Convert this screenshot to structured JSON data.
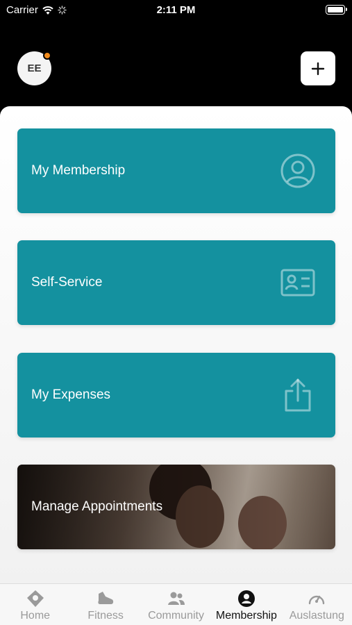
{
  "status_bar": {
    "carrier": "Carrier",
    "time": "2:11 PM"
  },
  "header": {
    "avatar_initials": "EE",
    "notification_color": "#f08a1c"
  },
  "cards": [
    {
      "label": "My Membership",
      "icon": "person-circle-icon"
    },
    {
      "label": "Self-Service",
      "icon": "id-card-icon"
    },
    {
      "label": "My Expenses",
      "icon": "share-icon"
    },
    {
      "label": "Manage Appointments",
      "icon": "photo-background"
    }
  ],
  "tabs": [
    {
      "label": "Home",
      "icon": "home-pin-icon",
      "active": false
    },
    {
      "label": "Fitness",
      "icon": "shoe-icon",
      "active": false
    },
    {
      "label": "Community",
      "icon": "people-icon",
      "active": false
    },
    {
      "label": "Membership",
      "icon": "person-circle-icon",
      "active": true
    },
    {
      "label": "Auslastung",
      "icon": "gauge-icon",
      "active": false
    }
  ],
  "colors": {
    "card": "#14919f",
    "active_tab": "#111111",
    "inactive_tab": "#9a9a9a"
  }
}
